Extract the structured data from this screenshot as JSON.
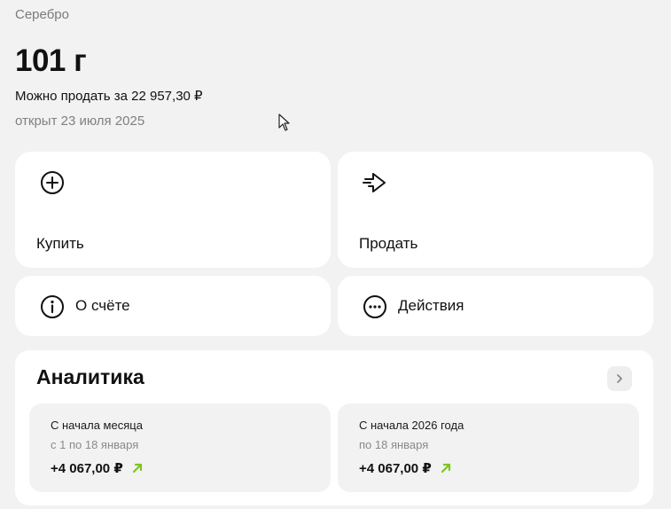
{
  "header": {
    "asset_name": "Серебро",
    "amount": "101 г",
    "sell_hint": "Можно продать за 22 957,30 ₽",
    "opened": "открыт 23 июля 2025"
  },
  "actions": {
    "buy_label": "Купить",
    "sell_label": "Продать",
    "about_label": "О счёте",
    "more_label": "Действия"
  },
  "analytics": {
    "title": "Аналитика",
    "stats": [
      {
        "title": "С начала месяца",
        "subtitle": "с 1 по 18 января",
        "value": "+4 067,00 ₽"
      },
      {
        "title": "С начала 2026 года",
        "subtitle": "по 18 января",
        "value": "+4 067,00 ₽"
      }
    ]
  },
  "colors": {
    "background": "#f2f2f2",
    "card": "#ffffff",
    "positive": "#7cc51f"
  }
}
